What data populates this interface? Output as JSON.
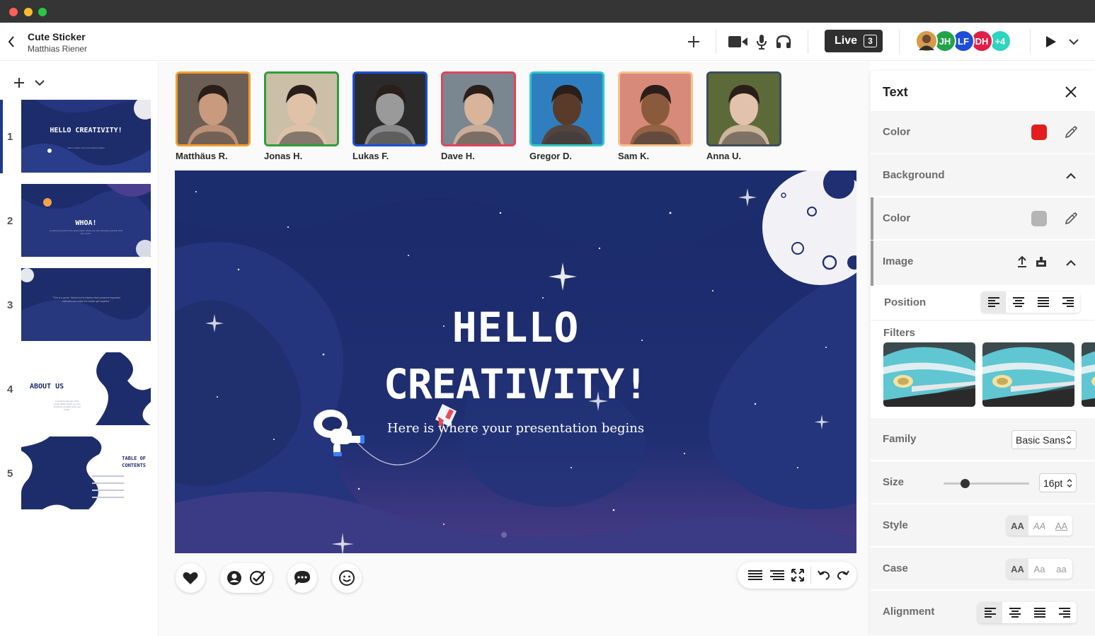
{
  "window": {
    "controls": [
      "close",
      "minimize",
      "maximize"
    ]
  },
  "header": {
    "doc_title": "Cute Sticker",
    "doc_author": "Matthias Riener",
    "live_label": "Live",
    "live_count": "3",
    "collaborators": [
      {
        "initials": "",
        "color": "#e0a040"
      },
      {
        "initials": "JH",
        "color": "#22a34a"
      },
      {
        "initials": "LF",
        "color": "#1d4ed8"
      },
      {
        "initials": "DH",
        "color": "#e11d48"
      },
      {
        "initials": "+4",
        "color": "#2dd4bf"
      }
    ]
  },
  "sidebar": {
    "slides": [
      {
        "number": "1",
        "title": "HELLO CREATIVITY!",
        "subtitle": "Here is where your presentation begins"
      },
      {
        "number": "2",
        "title": "WHOA!",
        "subtitle": "It could be the part of the presentation where you can introduce yourself, write your email..."
      },
      {
        "number": "3",
        "title": "",
        "subtitle": "\"This is a quote. Words full of wisdom that someone important said and can make the reader get inspired.\""
      },
      {
        "number": "4",
        "title": "ABOUT US",
        "subtitle": "It could be the part of the presentation where you can introduce yourself, write your email..."
      },
      {
        "number": "5",
        "title": "TABLE OF CONTENTS",
        "subtitle": ""
      }
    ]
  },
  "participants": [
    {
      "name": "Matthäus R.",
      "color": "#f59e2e",
      "skin": "#c99a7e",
      "bg": "#6b5f55"
    },
    {
      "name": "Jonas H.",
      "color": "#2e9e3a",
      "skin": "#e0c2a8",
      "bg": "#cbbfa8"
    },
    {
      "name": "Lukas F.",
      "color": "#1d4ed8",
      "skin": "#9a9a9a",
      "bg": "#2b2b2b"
    },
    {
      "name": "Dave H.",
      "color": "#e2445c",
      "skin": "#d8b49a",
      "bg": "#7a8690"
    },
    {
      "name": "Gregor D.",
      "color": "#2ec7c9",
      "skin": "#5a3a28",
      "bg": "#2f7fc0"
    },
    {
      "name": "Sam K.",
      "color": "#f6c28e",
      "skin": "#8a5a3c",
      "bg": "#d88a7a"
    },
    {
      "name": "Anna U.",
      "color": "#3d4d5c",
      "skin": "#e2c2ac",
      "bg": "#5c6a3a"
    }
  ],
  "slide": {
    "title_line1": "HELLO",
    "title_line2": "CREATIVITY!",
    "subtitle": "Here is where your presentation begins"
  },
  "panel": {
    "title": "Text",
    "color_label": "Color",
    "color_value": "#e11d1d",
    "background_label": "Background",
    "bg_color_label": "Color",
    "bg_color_value": "#b5b5b5",
    "image_label": "Image",
    "position_label": "Position",
    "filters_label": "Filters",
    "family_label": "Family",
    "family_value": "Basic Sans",
    "size_label": "Size",
    "size_value": "16pt",
    "size_slider_fraction": 0.25,
    "style_label": "Style",
    "style_options": [
      "AA",
      "AA",
      "AA"
    ],
    "case_label": "Case",
    "case_options": [
      "AA",
      "Aa",
      "aa"
    ],
    "alignment_label": "Alignment"
  }
}
